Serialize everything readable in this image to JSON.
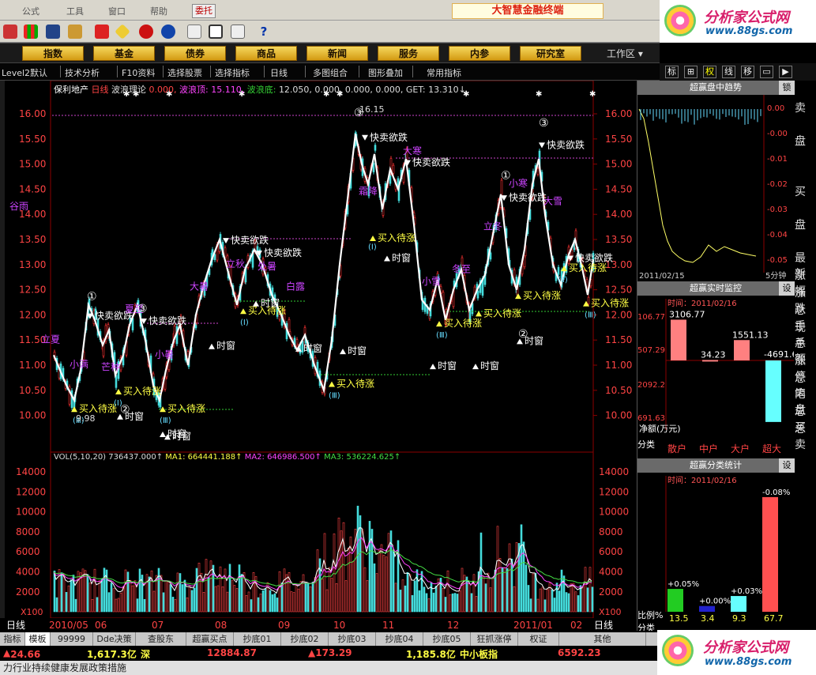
{
  "menubar": {
    "items": [
      "公式",
      "工具",
      "窗口",
      "帮助"
    ],
    "trade_button": "委托",
    "app_title": "大智慧金融终端"
  },
  "navbar": {
    "buttons": [
      "指数",
      "基金",
      "债券",
      "商品",
      "新闻",
      "服务",
      "内参",
      "研究室"
    ],
    "workarea": "工作区"
  },
  "tabbar": {
    "items": [
      "Level2默认",
      "技术分析",
      "F10资料",
      "选择股票",
      "选择指标",
      "日线",
      "多图组合",
      "图形叠加",
      "常用指标"
    ]
  },
  "right_tools": [
    "标",
    "⊞",
    "权",
    "线",
    "移",
    "▭",
    "▶"
  ],
  "chart": {
    "stock_name": "保利地产",
    "period": "日线",
    "indicator": "波浪理论",
    "indicator_value": "0.000,",
    "wave_top_label": "波浪顶:",
    "wave_top_value": "15.110,",
    "wave_bottom_label": "波浪底:",
    "wave_bottom_value": "12.050, 0.000, 0.000, 0.000,",
    "get_label": "GET:",
    "get_value": "13.310↓",
    "high_label": "16.15",
    "low_label": "9.98",
    "sell_label": "快卖欲跌",
    "buy_label": "买入待涨",
    "time_window_label": "时窗",
    "solar_terms": [
      "立夏",
      "小满",
      "芒种",
      "夏至",
      "小暑",
      "大暑",
      "立秋",
      "处暑",
      "白露",
      "霜降",
      "立冬",
      "小雪",
      "大雪",
      "冬至",
      "小寒",
      "大寒",
      "谷雨"
    ],
    "price_axis": [
      "16.00",
      "15.50",
      "15.00",
      "14.50",
      "14.00",
      "13.50",
      "13.00",
      "12.50",
      "12.00",
      "11.50",
      "11.00",
      "10.50",
      "10.00"
    ],
    "vol_info": {
      "label": "VOL(5,10,20)",
      "vol": "736437.000↑",
      "ma1": "MA1: 664441.188↑",
      "ma2": "MA2: 646986.500↑",
      "ma3": "MA3: 536224.625↑"
    },
    "vol_axis": [
      "14000",
      "12000",
      "10000",
      "8000",
      "6000",
      "4000",
      "2000"
    ],
    "vol_multiplier": "X100",
    "date_axis": [
      "2010/05",
      "06",
      "07",
      "08",
      "09",
      "10",
      "11",
      "12",
      "2011/01",
      "02"
    ],
    "period_label": "日线"
  },
  "trend_panel": {
    "title": "超赢盘中趋势",
    "lock": "锁",
    "axis": [
      "0.00",
      "-0.00",
      "-0.01",
      "-0.02",
      "-0.03",
      "-0.04",
      "-0.05"
    ],
    "date": "2011/02/15",
    "period": "5分钟"
  },
  "monitor_panel": {
    "title": "超赢实时监控",
    "settings": "设",
    "time": "时间：2011/02/16",
    "axis": [
      "106.77",
      "507.29",
      "2092.2",
      "691.63"
    ],
    "bars": [
      {
        "label": "散户",
        "value": 3106.77,
        "text": "3106.77",
        "color": "#ff8080"
      },
      {
        "label": "中户",
        "value": 34.23,
        "text": "34.23",
        "color": "#ff8080"
      },
      {
        "label": "大户",
        "value": 1551.13,
        "text": "1551.13",
        "color": "#ff8080"
      },
      {
        "label": "超大",
        "value": -4691.6,
        "text": "-4691.6",
        "color": "#66ffff"
      }
    ],
    "footer": "净额(万元)",
    "categories_label": "分类"
  },
  "stats_panel": {
    "title": "超赢分类统计",
    "settings": "设",
    "time": "时间：2011/02/16",
    "bars": [
      {
        "pct": "+0.05%",
        "value": 13.5,
        "color": "#22cc22",
        "text": "13.5"
      },
      {
        "pct": "+0.00%",
        "value": 3.4,
        "color": "#2222cc",
        "text": "3.4"
      },
      {
        "pct": "+0.03%",
        "value": 9.3,
        "color": "#66ffff",
        "text": "9.3"
      },
      {
        "pct": "-0.08%",
        "value": 67.7,
        "color": "#ff5050",
        "text": "67.7"
      }
    ],
    "ratio_label": "比例%",
    "categories_label": "分类"
  },
  "far_right": [
    "卖",
    "盘",
    "买",
    "盘",
    "最新",
    "涨幅",
    "涨跌",
    "总手",
    "现手",
    "总额",
    "涨停",
    "总笔",
    "内盘",
    "总买",
    "总卖"
  ],
  "bottom_tabs": [
    "指标",
    "模板",
    "99999",
    "Dde决策",
    "查股东",
    "超赢买点",
    "抄底01",
    "抄底02",
    "抄底03",
    "抄底04",
    "抄底05",
    "狂抓涨停",
    "权证",
    "其他"
  ],
  "ticker": {
    "item1": "24.66",
    "item2": "1,617.3亿",
    "item3": "深",
    "item4": "12884.87",
    "item5": "▲173.29",
    "item6": "1,185.8亿",
    "item7": "中小板指",
    "item8": "6592.23"
  },
  "news": "力行业持续健康发展政策措施",
  "logo": {
    "name": "分析家公式网",
    "url": "www.88gs.com"
  }
}
